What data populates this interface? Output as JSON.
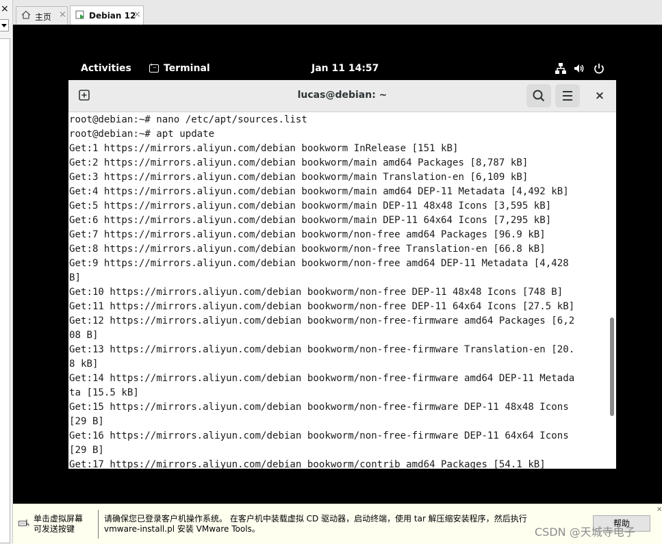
{
  "left_panel": {
    "close": "×"
  },
  "tabs": [
    {
      "label": "主页",
      "close": "×"
    },
    {
      "label": "Debian 12",
      "close": "×"
    }
  ],
  "gnome_top_bar": {
    "activities": "Activities",
    "app_name": "Terminal",
    "clock": "Jan 11  14:57",
    "tray_icons": [
      "network-icon",
      "volume-icon",
      "power-icon"
    ]
  },
  "terminal": {
    "title": "lucas@debian: ~",
    "close": "×",
    "lines": [
      "root@debian:~# nano /etc/apt/sources.list",
      "root@debian:~# apt update",
      "Get:1 https://mirrors.aliyun.com/debian bookworm InRelease [151 kB]",
      "Get:2 https://mirrors.aliyun.com/debian bookworm/main amd64 Packages [8,787 kB]",
      "Get:3 https://mirrors.aliyun.com/debian bookworm/main Translation-en [6,109 kB]",
      "Get:4 https://mirrors.aliyun.com/debian bookworm/main amd64 DEP-11 Metadata [4,492 kB]",
      "Get:5 https://mirrors.aliyun.com/debian bookworm/main DEP-11 48x48 Icons [3,595 kB]",
      "Get:6 https://mirrors.aliyun.com/debian bookworm/main DEP-11 64x64 Icons [7,295 kB]",
      "Get:7 https://mirrors.aliyun.com/debian bookworm/non-free amd64 Packages [96.9 kB]",
      "Get:8 https://mirrors.aliyun.com/debian bookworm/non-free Translation-en [66.8 kB]",
      "Get:9 https://mirrors.aliyun.com/debian bookworm/non-free amd64 DEP-11 Metadata [4,428",
      "B]",
      "Get:10 https://mirrors.aliyun.com/debian bookworm/non-free DEP-11 48x48 Icons [748 B]",
      "Get:11 https://mirrors.aliyun.com/debian bookworm/non-free DEP-11 64x64 Icons [27.5 kB]",
      "Get:12 https://mirrors.aliyun.com/debian bookworm/non-free-firmware amd64 Packages [6,2",
      "08 B]",
      "Get:13 https://mirrors.aliyun.com/debian bookworm/non-free-firmware Translation-en [20.",
      "8 kB]",
      "Get:14 https://mirrors.aliyun.com/debian bookworm/non-free-firmware amd64 DEP-11 Metada",
      "ta [15.5 kB]",
      "Get:15 https://mirrors.aliyun.com/debian bookworm/non-free-firmware DEP-11 48x48 Icons",
      "[29 B]",
      "Get:16 https://mirrors.aliyun.com/debian bookworm/non-free-firmware DEP-11 64x64 Icons",
      "[29 B]",
      "Get:17 https://mirrors.aliyun.com/debian bookworm/contrib amd64 Packages [54.1 kB]"
    ]
  },
  "hint_bar": {
    "left_line1": "单击虚拟屏幕",
    "left_line2": "可发送按键",
    "main_line1": "请确保您已登录客户机操作系统。 在客户机中装载虚拟 CD 驱动器，启动终端，使用 tar 解压缩安装程序，然后执行",
    "main_line2": "vmware-install.pl 安装 VMware Tools。",
    "help_button": "帮助",
    "close": "×"
  },
  "watermark": "CSDN @天城寺电子"
}
